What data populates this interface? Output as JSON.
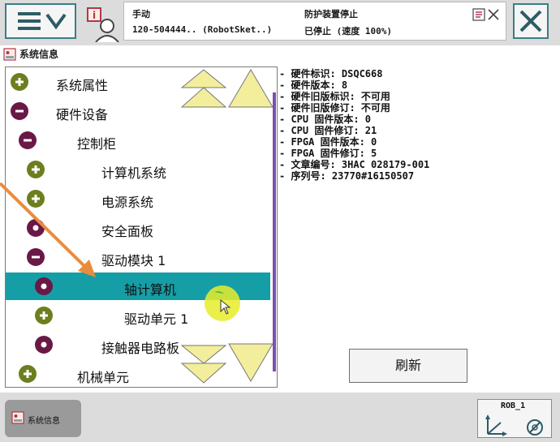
{
  "status": {
    "mode": "手动",
    "controller": "120-504444.. (RobotSket..)",
    "safety": "防护装置停止",
    "state": "已停止 (速度 100%)"
  },
  "app_title": "系统信息",
  "tree": {
    "items": [
      {
        "label": "系统属性",
        "node": "plus"
      },
      {
        "label": "硬件设备",
        "node": "minus"
      },
      {
        "label": "控制柜",
        "node": "minus"
      },
      {
        "label": "计算机系统",
        "node": "plus"
      },
      {
        "label": "电源系统",
        "node": "plus"
      },
      {
        "label": "安全面板",
        "node": "leaf"
      },
      {
        "label": "驱动模块 1",
        "node": "minus"
      },
      {
        "label": "轴计算机",
        "node": "leaf",
        "selected": true
      },
      {
        "label": "驱动单元 1",
        "node": "plus"
      },
      {
        "label": "接触器电路板",
        "node": "leaf"
      },
      {
        "label": "机械单元",
        "node": "plus"
      }
    ]
  },
  "info": {
    "lines": [
      "- 硬件标识: DSQC668",
      "- 硬件版本: 8",
      "- 硬件旧版标识: 不可用",
      "- 硬件旧版修订: 不可用",
      "- CPU 固件版本: 0",
      "- CPU 固件修订: 21",
      "- FPGA 固件版本: 0",
      "- FPGA 固件修订: 5",
      "- 文章编号: 3HAC 028179-001",
      "- 序列号: 23770#16150507"
    ]
  },
  "refresh_label": "刷新",
  "taskbar": {
    "item_label": "系统信息"
  },
  "rob_label": "ROB_1",
  "colors": {
    "accent": "#3a7e86",
    "selection": "#169ea6",
    "node_green": "#6b7f1f",
    "node_maroon": "#6a1846",
    "scroll_arrow": "#f2ee9c",
    "annotation_arrow": "#ea8b3c"
  }
}
